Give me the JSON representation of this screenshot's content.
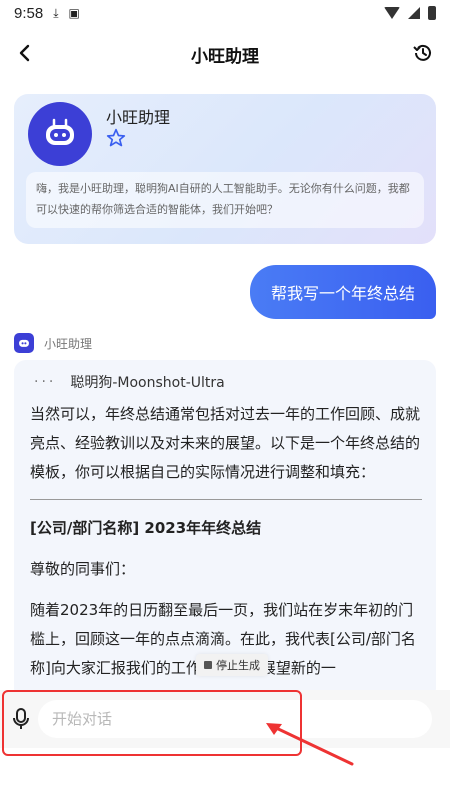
{
  "status_bar": {
    "time": "9:58"
  },
  "header": {
    "title": "小旺助理"
  },
  "intro": {
    "name": "小旺助理",
    "description": "嗨，我是小旺助理，聪明狗AI自研的人工智能助手。无论你有什么问题，我都可以快速的帮你筛选合适的智能体，我们开始吧？"
  },
  "user_message": {
    "text": "帮我写一个年终总结"
  },
  "bot": {
    "name": "小旺助理",
    "model": "聪明狗-Moonshot-Ultra",
    "paragraph_1": "当然可以，年终总结通常包括对过去一年的工作回顾、成就亮点、经验教训以及对未来的展望。以下是一个年终总结的模板，你可以根据自己的实际情况进行调整和填充：",
    "heading": "[公司/部门名称] 2023年年终总结",
    "greeting": "尊敬的同事们：",
    "paragraph_2": "随着2023年的日历翻至最后一页，我们站在岁末年初的门槛上，回顾这一年的点点滴滴。在此，我代表[公司/部门名称]向大家汇报我们的工作总结，并展望新的一"
  },
  "stop_button": {
    "label": "停止生成"
  },
  "input": {
    "placeholder": "开始对话",
    "value": ""
  },
  "colors": {
    "accent": "#3a5ff0",
    "avatar": "#3c3fd6",
    "highlight": "#e33333"
  }
}
